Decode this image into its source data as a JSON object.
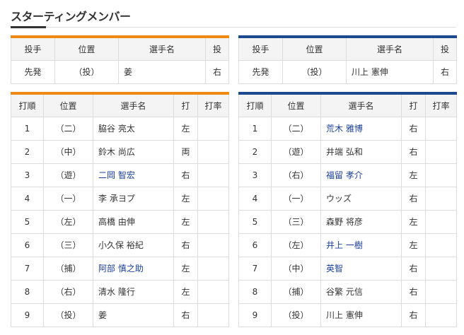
{
  "section_title": "スターティングメンバー",
  "pitcher_headers": [
    "投手",
    "位置",
    "選手名",
    "投"
  ],
  "batting_headers": [
    "打順",
    "位置",
    "選手名",
    "打",
    "打率"
  ],
  "home": {
    "accent_color": "#ee8a13",
    "pitcher": {
      "role": "先発",
      "pos": "（投）",
      "name": "姜",
      "hand": "右"
    },
    "lineup": [
      {
        "order": "1",
        "pos": "（二）",
        "name": "脇谷 亮太",
        "hand": "左",
        "avg": "",
        "link": false
      },
      {
        "order": "2",
        "pos": "（中）",
        "name": "鈴木 尚広",
        "hand": "両",
        "avg": "",
        "link": false
      },
      {
        "order": "3",
        "pos": "（遊）",
        "name": "二岡 智宏",
        "hand": "右",
        "avg": "",
        "link": true
      },
      {
        "order": "4",
        "pos": "（一）",
        "name": "李 承ヨプ",
        "hand": "左",
        "avg": "",
        "link": false
      },
      {
        "order": "5",
        "pos": "（左）",
        "name": "高橋 由伸",
        "hand": "左",
        "avg": "",
        "link": false
      },
      {
        "order": "6",
        "pos": "（三）",
        "name": "小久保 裕紀",
        "hand": "右",
        "avg": "",
        "link": false
      },
      {
        "order": "7",
        "pos": "（捕）",
        "name": "阿部 慎之助",
        "hand": "左",
        "avg": "",
        "link": true
      },
      {
        "order": "8",
        "pos": "（右）",
        "name": "清水 隆行",
        "hand": "左",
        "avg": "",
        "link": false
      },
      {
        "order": "9",
        "pos": "（投）",
        "name": "姜",
        "hand": "右",
        "avg": "",
        "link": false
      }
    ]
  },
  "away": {
    "accent_color": "#1d4a8c",
    "pitcher": {
      "role": "先発",
      "pos": "（投）",
      "name": "川上 憲伸",
      "hand": "右"
    },
    "lineup": [
      {
        "order": "1",
        "pos": "（二）",
        "name": "荒木 雅博",
        "hand": "右",
        "avg": "",
        "link": true
      },
      {
        "order": "2",
        "pos": "（遊）",
        "name": "井端 弘和",
        "hand": "右",
        "avg": "",
        "link": false
      },
      {
        "order": "3",
        "pos": "（右）",
        "name": "福留 孝介",
        "hand": "左",
        "avg": "",
        "link": true
      },
      {
        "order": "4",
        "pos": "（一）",
        "name": "ウッズ",
        "hand": "右",
        "avg": "",
        "link": false
      },
      {
        "order": "5",
        "pos": "（三）",
        "name": "森野 将彦",
        "hand": "左",
        "avg": "",
        "link": false
      },
      {
        "order": "6",
        "pos": "（左）",
        "name": "井上 一樹",
        "hand": "左",
        "avg": "",
        "link": true
      },
      {
        "order": "7",
        "pos": "（中）",
        "name": "英智",
        "hand": "右",
        "avg": "",
        "link": true
      },
      {
        "order": "8",
        "pos": "（捕）",
        "name": "谷繁 元信",
        "hand": "右",
        "avg": "",
        "link": false
      },
      {
        "order": "9",
        "pos": "（投）",
        "name": "川上 憲伸",
        "hand": "右",
        "avg": "",
        "link": false
      }
    ]
  }
}
